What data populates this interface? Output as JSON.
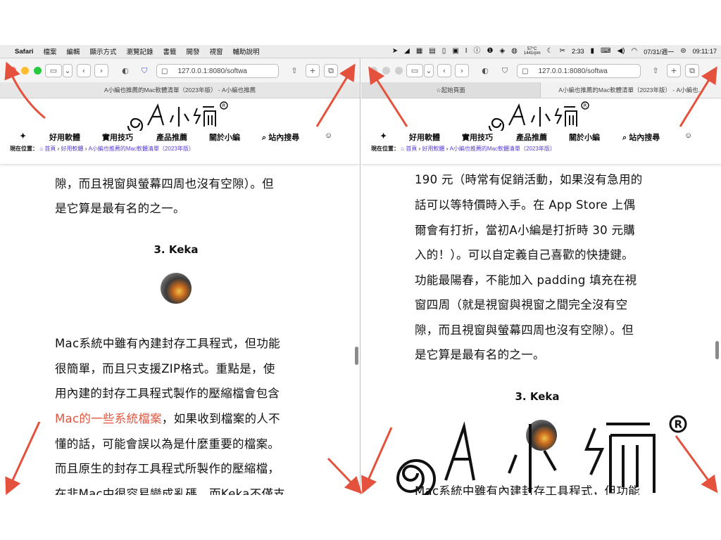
{
  "menubar": {
    "apple": "",
    "items": [
      "Safari",
      "檔案",
      "編輯",
      "顯示方式",
      "瀏覽記錄",
      "書籤",
      "開發",
      "視窗",
      "輔助說明"
    ],
    "temp": "57°C",
    "fan": "1441rpm",
    "battery_time": "2:33",
    "date": "07/31/週一",
    "time": "09:11:17"
  },
  "left": {
    "url": "127.0.0.1:8080/softwa",
    "tab_title": "A小編也推薦的Mac軟體清單（2023年版） - A小編也推薦",
    "nav": [
      "好用軟體",
      "實用技巧",
      "產品推薦",
      "關於小編",
      "站內搜尋"
    ],
    "crumb": {
      "prefix": "現在位置：",
      "home": "首頁",
      "sep": "›",
      "cat": "好用軟體",
      "page": "A小編也推薦的Mac軟體清單（2023年版）"
    },
    "lines_top": [
      "隙，而且視窗與螢幕四周也沒有空隙）。但",
      "是它算是最有名的之一。"
    ],
    "heading": "3.  Keka",
    "lines_body": [
      "Mac系統中雖有內建封存工具程式，但功能",
      "很簡單，而且只支援ZIP格式。重點是，使",
      "用內建的封存工具程式製作的壓縮檔會包含"
    ],
    "link_text": "Mac的一些系統檔案",
    "link_after": "，如果收到檔案的人不",
    "lines_after": [
      "懂的話，可能會誤以為是什麼重要的檔案。",
      "而且原生的封存工具程式所製作的壓縮檔，",
      "在非Mac中很容易變成亂碼。而Keka不僅支"
    ]
  },
  "right": {
    "url": "127.0.0.1:8080/softwa",
    "tabs": [
      "起始頁面",
      "A小編也推薦的Mac軟體清單（2023年版） - A小編也..."
    ],
    "nav": [
      "好用軟體",
      "實用技巧",
      "產品推薦",
      "關於小編",
      "站內搜尋"
    ],
    "crumb": {
      "prefix": "現在位置：",
      "home": "首頁",
      "sep": "›",
      "cat": "好用軟體",
      "page": "A小編也推薦的Mac軟體清單（2023年版）"
    },
    "lines": [
      "190 元（時常有促銷活動，如果沒有急用的",
      "話可以等特價時入手。在 App Store 上偶",
      "爾會有打折，當初A小編是打折時 30 元購",
      "入的！）。可以自定義自己喜歡的快捷鍵。",
      "功能最陽春，不能加入 padding 填充在視",
      "窗四周（就是視窗與視窗之間完全沒有空",
      "隙，而且視窗與螢幕四周也沒有空隙）。但",
      "是它算是最有名的之一。"
    ],
    "heading": "3.  Keka",
    "line_bottom": "Mac系統中雖有內建封存工具程式，但功能"
  },
  "colors": {
    "accent_red": "#e0533d",
    "link_purple": "#5b3fd0",
    "arrow_red": "#e4513c"
  }
}
